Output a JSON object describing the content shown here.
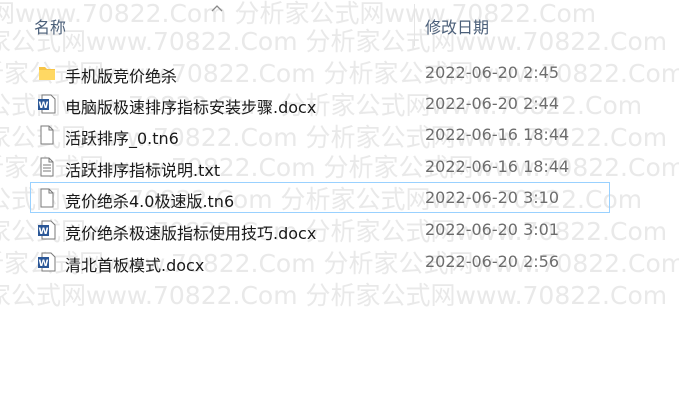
{
  "header": {
    "name_col": "名称",
    "date_col": "修改日期"
  },
  "watermark": {
    "line0": "公式网www.70822.Com 分析家公式网www.70822.Com",
    "line1": "家公式网www.70822.Com 分析家公式网www.70822.Com",
    "line2": "分析家公式网www.70822.Com 分析家公式网www.70822.Com",
    "line3": "公式网www.70822.Com 分析家公式网www.70822.Com",
    "line4": "家公式网www.70822.Com 分析家公式网www.70822.Com",
    "line5": "分析家公式网www.70822.Com 分析家公式网www.70822.Com",
    "line6": "公式网www.70822.Com 分析家公式网www.70822.Com",
    "line7": "家公式网www.70822.Com 分析家公式网www.70822.Com",
    "line8": "分析家公式网www.70822.Com 分析家公式网www.70822.Com",
    "line9": "家公式网www.70822.Com 分析家公式网www.70822.Com"
  },
  "files": [
    {
      "name": "手机版竞价绝杀",
      "date": "2022-06-20 2:45",
      "icon": "folder-icon"
    },
    {
      "name": "电脑版极速排序指标安装步骤.docx",
      "date": "2022-06-20 2:44",
      "icon": "word-doc-icon"
    },
    {
      "name": "活跃排序_0.tn6",
      "date": "2022-06-16 18:44",
      "icon": "blank-file-icon"
    },
    {
      "name": "活跃排序指标说明.txt",
      "date": "2022-06-16 18:44",
      "icon": "text-file-icon"
    },
    {
      "name": "竞价绝杀4.0极速版.tn6",
      "date": "2022-06-20 3:10",
      "icon": "blank-file-icon"
    },
    {
      "name": "竞价绝杀极速版指标使用技巧.docx",
      "date": "2022-06-20 3:01",
      "icon": "word-doc-icon"
    },
    {
      "name": "清北首板模式.docx",
      "date": "2022-06-20 2:56",
      "icon": "word-doc-icon"
    }
  ],
  "colors": {
    "header_text": "#4c607a",
    "selection_border": "#99d1ff",
    "folder": "#f7c548",
    "word_blue": "#2b5797"
  }
}
